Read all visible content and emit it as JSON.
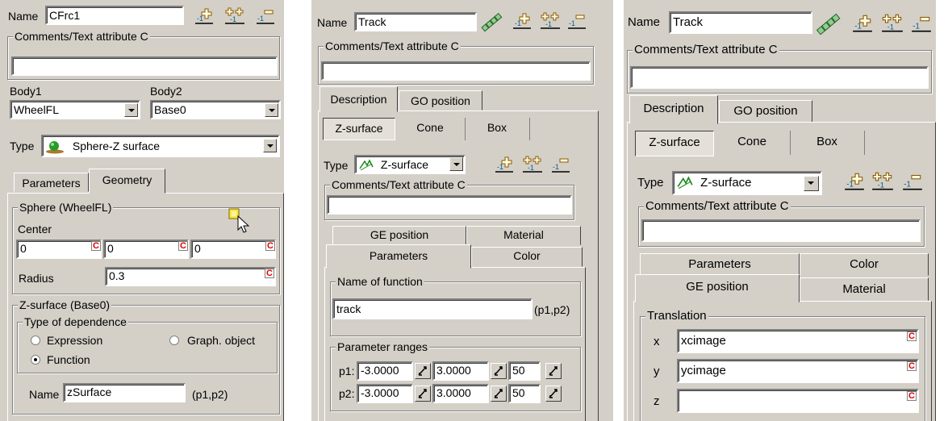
{
  "panel1": {
    "name_label": "Name",
    "name_value": "CFrc1",
    "comments_label": "Comments/Text attribute C",
    "comments_value": "",
    "body1_label": "Body1",
    "body1_value": "WheelFL",
    "body2_label": "Body2",
    "body2_value": "Base0",
    "type_label": "Type",
    "type_value": "Sphere-Z surface",
    "tabs": [
      "Parameters",
      "Geometry"
    ],
    "sphere_group": "Sphere (WheelFL)",
    "center_label": "Center",
    "center_values": [
      "0",
      "0",
      "0"
    ],
    "c_marker": "C",
    "radius_label": "Radius",
    "radius_value": "0.3",
    "zsurface_group": "Z-surface (Base0)",
    "dependence_group": "Type of dependence",
    "radio_expression": "Expression",
    "radio_graph": "Graph. object",
    "radio_function": "Function",
    "fname_label": "Name",
    "fname_value": "zSurface",
    "fname_suffix": "(p1,p2)"
  },
  "panel2": {
    "name_label": "Name",
    "name_value": "Track",
    "comments_label": "Comments/Text attribute C",
    "tabs": [
      "Description",
      "GO position"
    ],
    "subtabs": [
      "Z-surface",
      "Cone",
      "Box"
    ],
    "type_label": "Type",
    "type_value": "Z-surface",
    "comments2_label": "Comments/Text attribute C",
    "tabs_back": [
      "GE position",
      "Material"
    ],
    "tabs_front": [
      "Parameters",
      "Color"
    ],
    "function_group": "Name of function",
    "function_value": "track",
    "function_suffix": "(p1,p2)",
    "ranges_group": "Parameter ranges",
    "p1_label": "p1:",
    "p1_values": [
      "-3.0000",
      "3.0000",
      "50"
    ],
    "p2_label": "p2:",
    "p2_values": [
      "-3.0000",
      "3.0000",
      "50"
    ]
  },
  "panel3": {
    "name_label": "Name",
    "name_value": "Track",
    "comments_label": "Comments/Text attribute C",
    "tabs": [
      "Description",
      "GO position"
    ],
    "subtabs": [
      "Z-surface",
      "Cone",
      "Box"
    ],
    "type_label": "Type",
    "type_value": "Z-surface",
    "comments2_label": "Comments/Text attribute C",
    "tabs_back": [
      "Parameters",
      "Color"
    ],
    "tabs_front": [
      "GE position",
      "Material"
    ],
    "translation_group": "Translation",
    "x_label": "x",
    "x_value": "xcimage",
    "y_label": "y",
    "y_value": "ycimage",
    "z_label": "z",
    "z_value": "",
    "c_marker": "C"
  }
}
